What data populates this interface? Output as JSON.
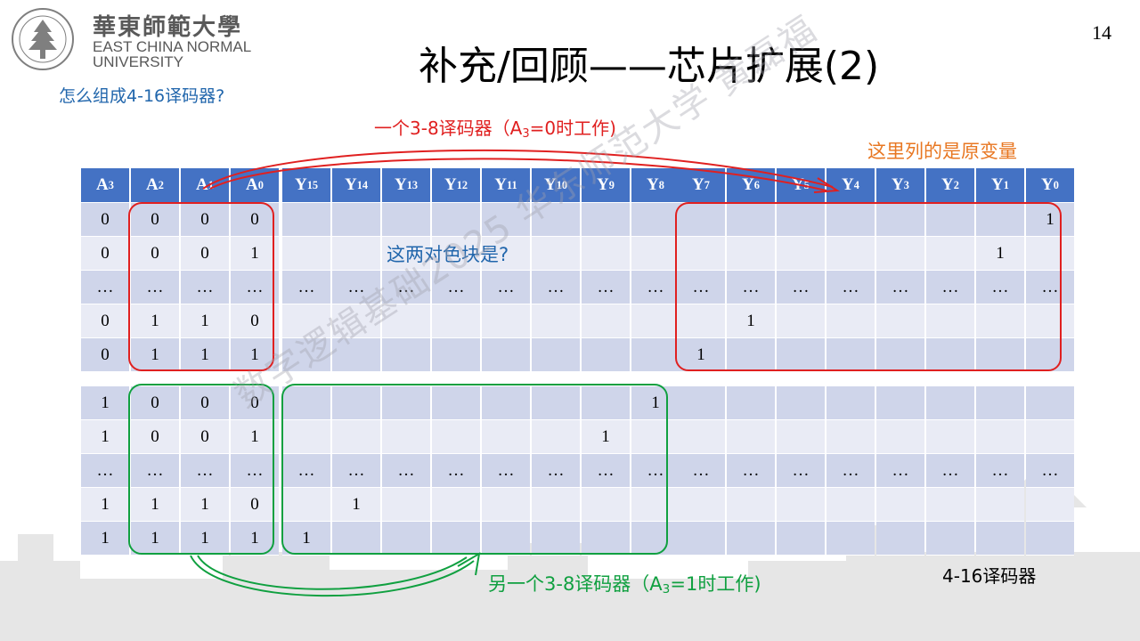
{
  "slide": {
    "page_number": "14",
    "title": "补充/回顾——芯片扩展(2)",
    "question": "怎么组成4-16译码器?",
    "red_note_prefix": "一个3-8译码器（A",
    "red_note_sub": "3",
    "red_note_suffix": "=0时工作)",
    "orange_note": "这里列的是原变量",
    "blue_note": "这两对色块是?",
    "green_note_prefix": "另一个3-8译码器（A",
    "green_note_sub": "3",
    "green_note_suffix": "=1时工作)",
    "black_note": "4-16译码器",
    "watermark": "数字逻辑基础2025 华东师范大学 黄磊福"
  },
  "logo": {
    "cn": "華東師範大學",
    "en_line1": "EAST CHINA NORMAL",
    "en_line2": "UNIVERSITY",
    "seal_text": "EAST CHINA NORMAL UNIVERSITY"
  },
  "colors": {
    "header_blue": "#4472c4",
    "row_dark": "#cfd5ea",
    "row_light": "#e9ebf5",
    "red": "#e02020",
    "green": "#10a040",
    "orange": "#e87722",
    "blue_text": "#2166ac"
  },
  "tables": {
    "inputs": {
      "headers": [
        [
          "A",
          "3"
        ],
        [
          "A",
          "2"
        ],
        [
          "A",
          "1"
        ],
        [
          "A",
          "0"
        ]
      ],
      "top_rows": [
        [
          "0",
          "0",
          "0",
          "0"
        ],
        [
          "0",
          "0",
          "0",
          "1"
        ],
        [
          "…",
          "…",
          "…",
          "…"
        ],
        [
          "0",
          "1",
          "1",
          "0"
        ],
        [
          "0",
          "1",
          "1",
          "1"
        ]
      ],
      "bottom_rows": [
        [
          "1",
          "0",
          "0",
          "0"
        ],
        [
          "1",
          "0",
          "0",
          "1"
        ],
        [
          "…",
          "…",
          "…",
          "…"
        ],
        [
          "1",
          "1",
          "1",
          "0"
        ],
        [
          "1",
          "1",
          "1",
          "1"
        ]
      ]
    },
    "outputs_high": {
      "headers": [
        [
          "Y",
          "15"
        ],
        [
          "Y",
          "14"
        ],
        [
          "Y",
          "13"
        ],
        [
          "Y",
          "12"
        ],
        [
          "Y",
          "11"
        ],
        [
          "Y",
          "10"
        ],
        [
          "Y",
          "9"
        ],
        [
          "Y",
          "8"
        ]
      ],
      "top_rows": [
        [
          "",
          "",
          "",
          "",
          "",
          "",
          "",
          ""
        ],
        [
          "",
          "",
          "",
          "",
          "",
          "",
          "",
          ""
        ],
        [
          "…",
          "…",
          "…",
          "…",
          "…",
          "…",
          "…",
          "…"
        ],
        [
          "",
          "",
          "",
          "",
          "",
          "",
          "",
          ""
        ],
        [
          "",
          "",
          "",
          "",
          "",
          "",
          "",
          ""
        ]
      ],
      "bottom_rows": [
        [
          "",
          "",
          "",
          "",
          "",
          "",
          "",
          "1"
        ],
        [
          "",
          "",
          "",
          "",
          "",
          "",
          "1",
          ""
        ],
        [
          "…",
          "…",
          "…",
          "…",
          "…",
          "…",
          "…",
          "…"
        ],
        [
          "",
          "1",
          "",
          "",
          "",
          "",
          "",
          ""
        ],
        [
          "1",
          "",
          "",
          "",
          "",
          "",
          "",
          ""
        ]
      ]
    },
    "outputs_low": {
      "headers": [
        [
          "Y",
          "7"
        ],
        [
          "Y",
          "6"
        ],
        [
          "Y",
          "5"
        ],
        [
          "Y",
          "4"
        ],
        [
          "Y",
          "3"
        ],
        [
          "Y",
          "2"
        ],
        [
          "Y",
          "1"
        ],
        [
          "Y",
          "0"
        ]
      ],
      "top_rows": [
        [
          "",
          "",
          "",
          "",
          "",
          "",
          "",
          "1"
        ],
        [
          "",
          "",
          "",
          "",
          "",
          "",
          "1",
          ""
        ],
        [
          "…",
          "…",
          "…",
          "…",
          "…",
          "…",
          "…",
          "…"
        ],
        [
          "",
          "1",
          "",
          "",
          "",
          "",
          "",
          ""
        ],
        [
          "1",
          "",
          "",
          "",
          "",
          "",
          "",
          ""
        ]
      ],
      "bottom_rows": [
        [
          "",
          "",
          "",
          "",
          "",
          "",
          "",
          ""
        ],
        [
          "",
          "",
          "",
          "",
          "",
          "",
          "",
          ""
        ],
        [
          "…",
          "…",
          "…",
          "…",
          "…",
          "…",
          "…",
          "…"
        ],
        [
          "",
          "",
          "",
          "",
          "",
          "",
          "",
          ""
        ],
        [
          "",
          "",
          "",
          "",
          "",
          "",
          "",
          ""
        ]
      ]
    }
  }
}
